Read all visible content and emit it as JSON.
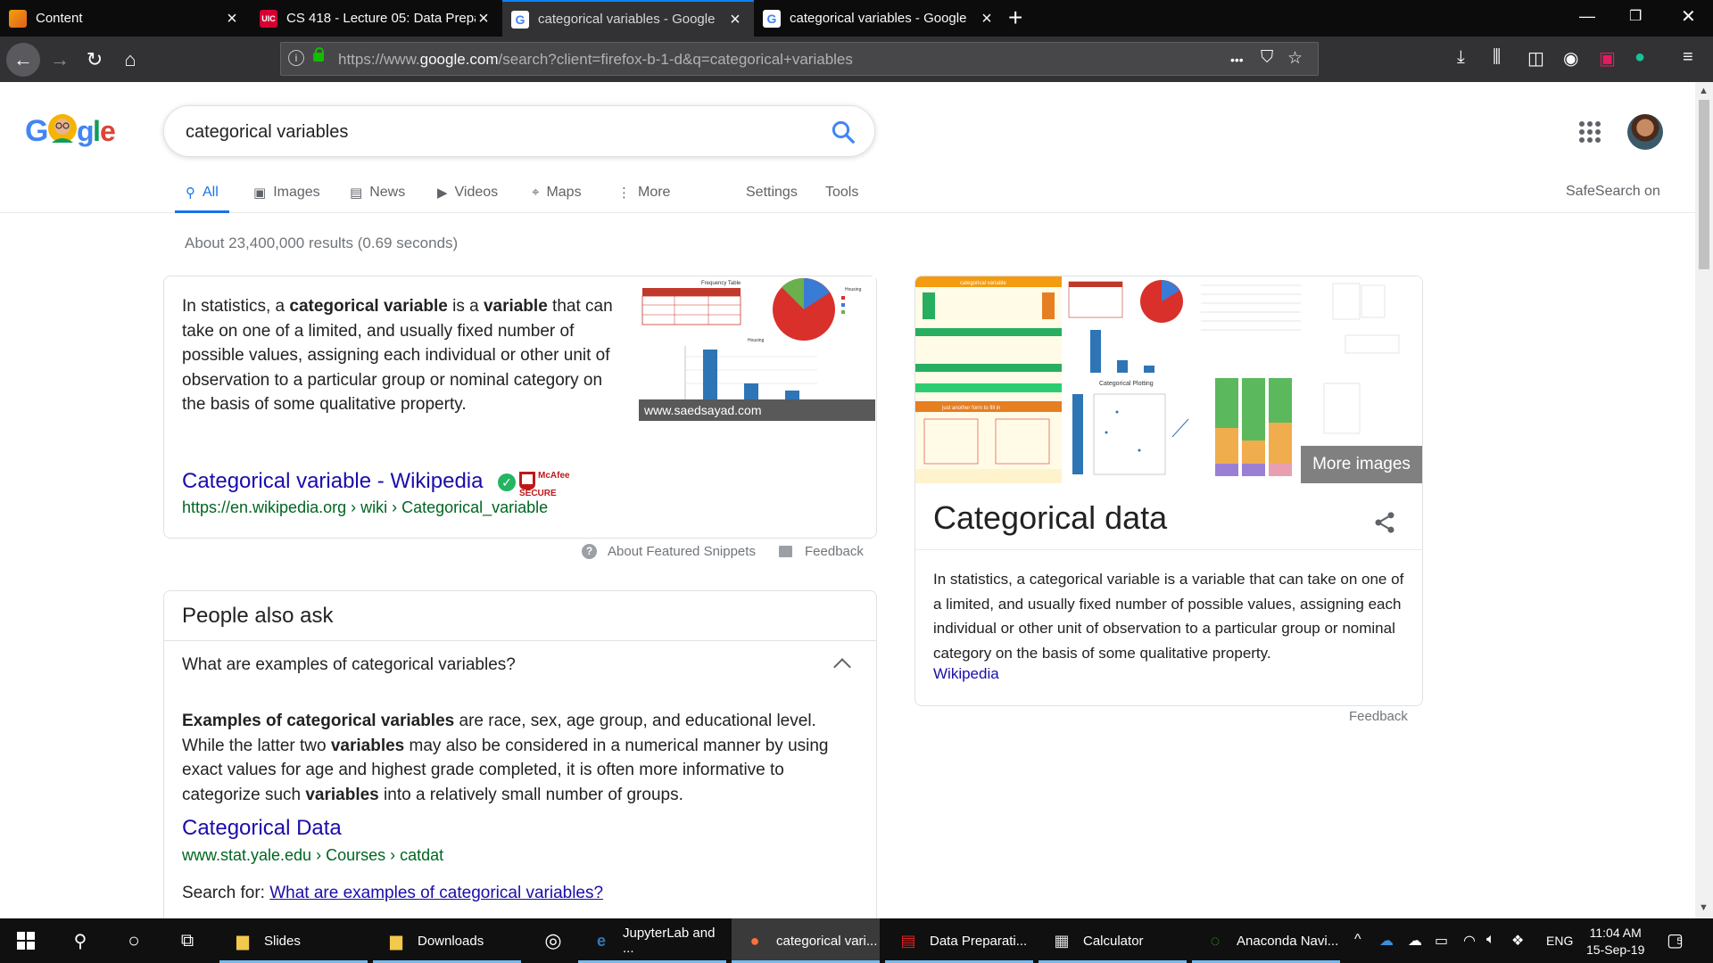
{
  "browser": {
    "tabs": [
      {
        "title": "Content",
        "favicon": "content-icon",
        "active": false
      },
      {
        "title": "CS 418 - Lecture 05: Data Prepa",
        "favicon": "uic-icon",
        "active": false
      },
      {
        "title": "categorical variables - Google",
        "favicon": "google-icon",
        "active": true
      },
      {
        "title": "categorical variables - Google",
        "favicon": "google-icon",
        "active": false
      }
    ],
    "url_prefix": "https://www.",
    "url_domain": "google.com",
    "url_rest": "/search?client=firefox-b-1-d&q=categorical+variables",
    "more_glyph": "•••"
  },
  "google": {
    "query": "categorical variables",
    "nav": {
      "all": "All",
      "images": "Images",
      "news": "News",
      "videos": "Videos",
      "maps": "Maps",
      "more": "More",
      "settings": "Settings",
      "tools": "Tools"
    },
    "safesearch": "SafeSearch on",
    "result_stats": "About 23,400,000 results (0.69 seconds)",
    "snippet": {
      "t1": "In statistics, a ",
      "b1": "categorical variable",
      "t2": " is a ",
      "b2": "variable",
      "t3": " that can take on one of a limited, and usually fixed number of possible values, assigning each individual or other unit of observation to a particular group or nominal category on the basis of some qualitative property.",
      "image_caption": "www.saedsayad.com",
      "image_title": "Frequency Table",
      "image_chart_title": "Housing",
      "link_title": "Categorical variable - Wikipedia",
      "cite": "https://en.wikipedia.org › wiki › Categorical_variable",
      "mcafee_line1": "McAfee",
      "mcafee_line2": "SECURE",
      "about": "About Featured Snippets",
      "feedback": "Feedback"
    },
    "people_also_ask": {
      "title": "People also ask",
      "question": "What are examples of categorical variables?",
      "a_b1": "Examples of categorical variables",
      "a_t1": " are race, sex, age group, and educational level. While the latter two ",
      "a_b2": "variables",
      "a_t2": " may also be considered in a numerical manner by using exact values for age and highest grade completed, it is often more informative to categorize such ",
      "a_b3": "variables",
      "a_t3": " into a relatively small number of groups.",
      "link_title": "Categorical Data",
      "cite": "www.stat.yale.edu › Courses › catdat",
      "more_prefix": "Search for: ",
      "more_link": "What are examples of categorical variables?"
    },
    "knowledge_panel": {
      "img1_banner": "categorical variable",
      "img1_label": "just another form to fill in",
      "img3_title": "Categorical Plotting",
      "more_images": "More images",
      "title": "Categorical data",
      "description": "In statistics, a categorical variable is a variable that can take on one of a limited, and usually fixed number of possible values, assigning each individual or other unit of observation to a particular group or nominal category on the basis of some qualitative property.",
      "source": "Wikipedia",
      "feedback": "Feedback"
    }
  },
  "taskbar": {
    "items": [
      {
        "label": "Slides",
        "icon": "folder-icon"
      },
      {
        "label": "Downloads",
        "icon": "folder-icon"
      },
      {
        "label": "JupyterLab and ...",
        "icon": "edge-icon"
      },
      {
        "label": "categorical vari...",
        "icon": "firefox-icon"
      },
      {
        "label": "Data Preparati...",
        "icon": "pdf-icon"
      },
      {
        "label": "Calculator",
        "icon": "calculator-icon"
      },
      {
        "label": "Anaconda Navi...",
        "icon": "anaconda-icon"
      }
    ],
    "lang": "ENG",
    "time": "11:04 AM",
    "date": "15-Sep-19",
    "notif_count": "5"
  }
}
